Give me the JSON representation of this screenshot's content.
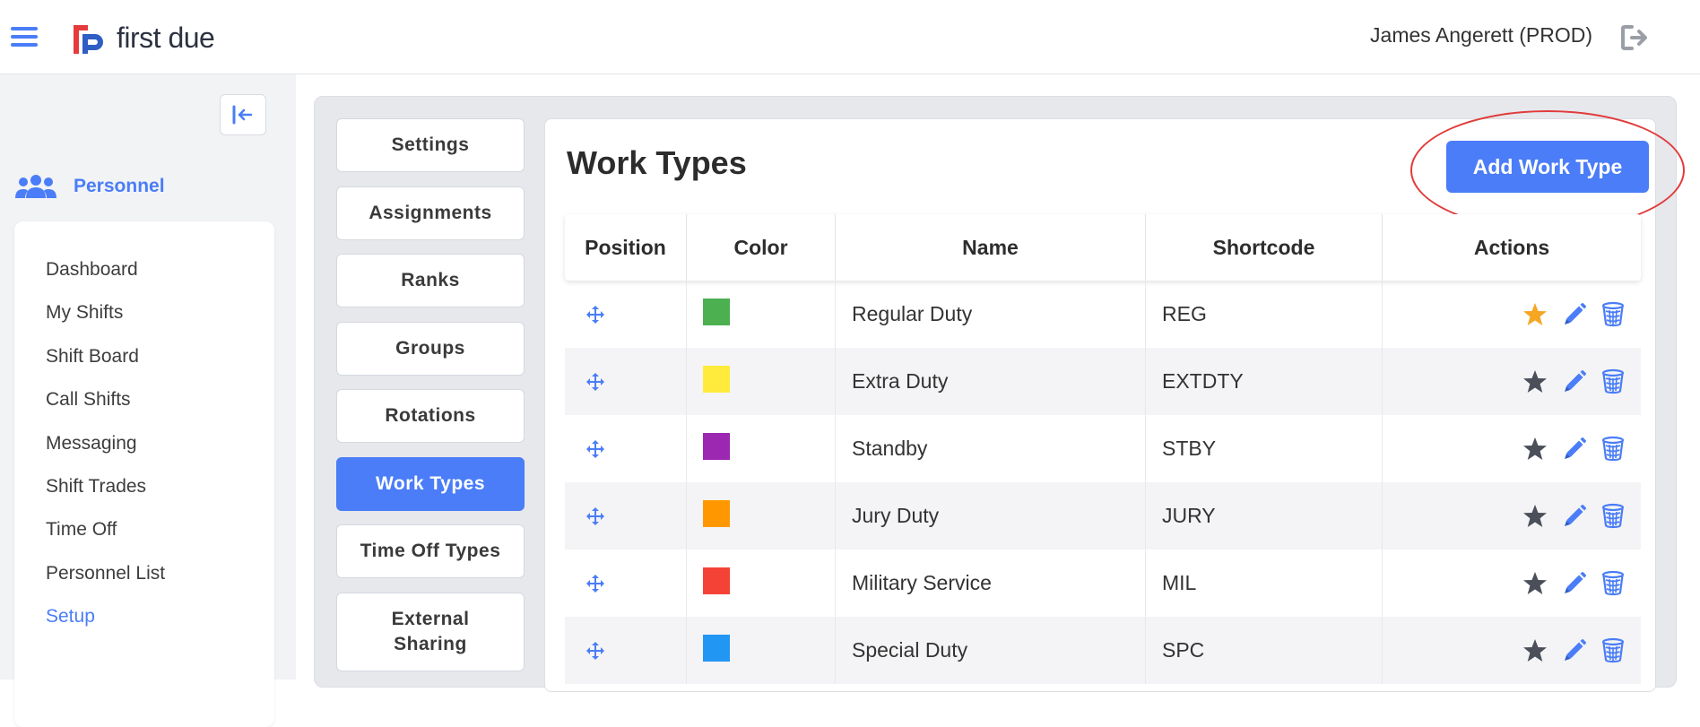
{
  "header": {
    "logo_text": "first due",
    "user_name": "James Angerett (PROD)"
  },
  "sidebar": {
    "section_label": "Personnel",
    "items": [
      {
        "label": "Dashboard",
        "active": false
      },
      {
        "label": "My Shifts",
        "active": false
      },
      {
        "label": "Shift Board",
        "active": false
      },
      {
        "label": "Call Shifts",
        "active": false
      },
      {
        "label": "Messaging",
        "active": false
      },
      {
        "label": "Shift Trades",
        "active": false
      },
      {
        "label": "Time Off",
        "active": false
      },
      {
        "label": "Personnel List",
        "active": false
      },
      {
        "label": "Setup",
        "active": true
      }
    ]
  },
  "tabs": [
    {
      "label": "Settings",
      "active": false
    },
    {
      "label": "Assignments",
      "active": false
    },
    {
      "label": "Ranks",
      "active": false
    },
    {
      "label": "Groups",
      "active": false
    },
    {
      "label": "Rotations",
      "active": false
    },
    {
      "label": "Work Types",
      "active": true
    },
    {
      "label": "Time Off Types",
      "active": false
    },
    {
      "label": "External Sharing",
      "active": false
    }
  ],
  "main": {
    "title": "Work Types",
    "add_button_label": "Add Work Type",
    "table": {
      "headers": [
        "Position",
        "Color",
        "Name",
        "Shortcode",
        "Actions"
      ],
      "rows": [
        {
          "color": "#4caf50",
          "name": "Regular Duty",
          "shortcode": "REG",
          "default": true
        },
        {
          "color": "#ffeb3b",
          "name": "Extra Duty",
          "shortcode": "EXTDTY",
          "default": false
        },
        {
          "color": "#9c27b0",
          "name": "Standby",
          "shortcode": "STBY",
          "default": false
        },
        {
          "color": "#ff9800",
          "name": "Jury Duty",
          "shortcode": "JURY",
          "default": false
        },
        {
          "color": "#f44336",
          "name": "Military Service",
          "shortcode": "MIL",
          "default": false
        },
        {
          "color": "#2196f3",
          "name": "Special Duty",
          "shortcode": "SPC",
          "default": false
        }
      ]
    }
  },
  "colors": {
    "accent": "#4a7df7",
    "star_default": "#f5a623",
    "star_normal": "#4a4f5a",
    "highlight": "#e23b3b"
  }
}
